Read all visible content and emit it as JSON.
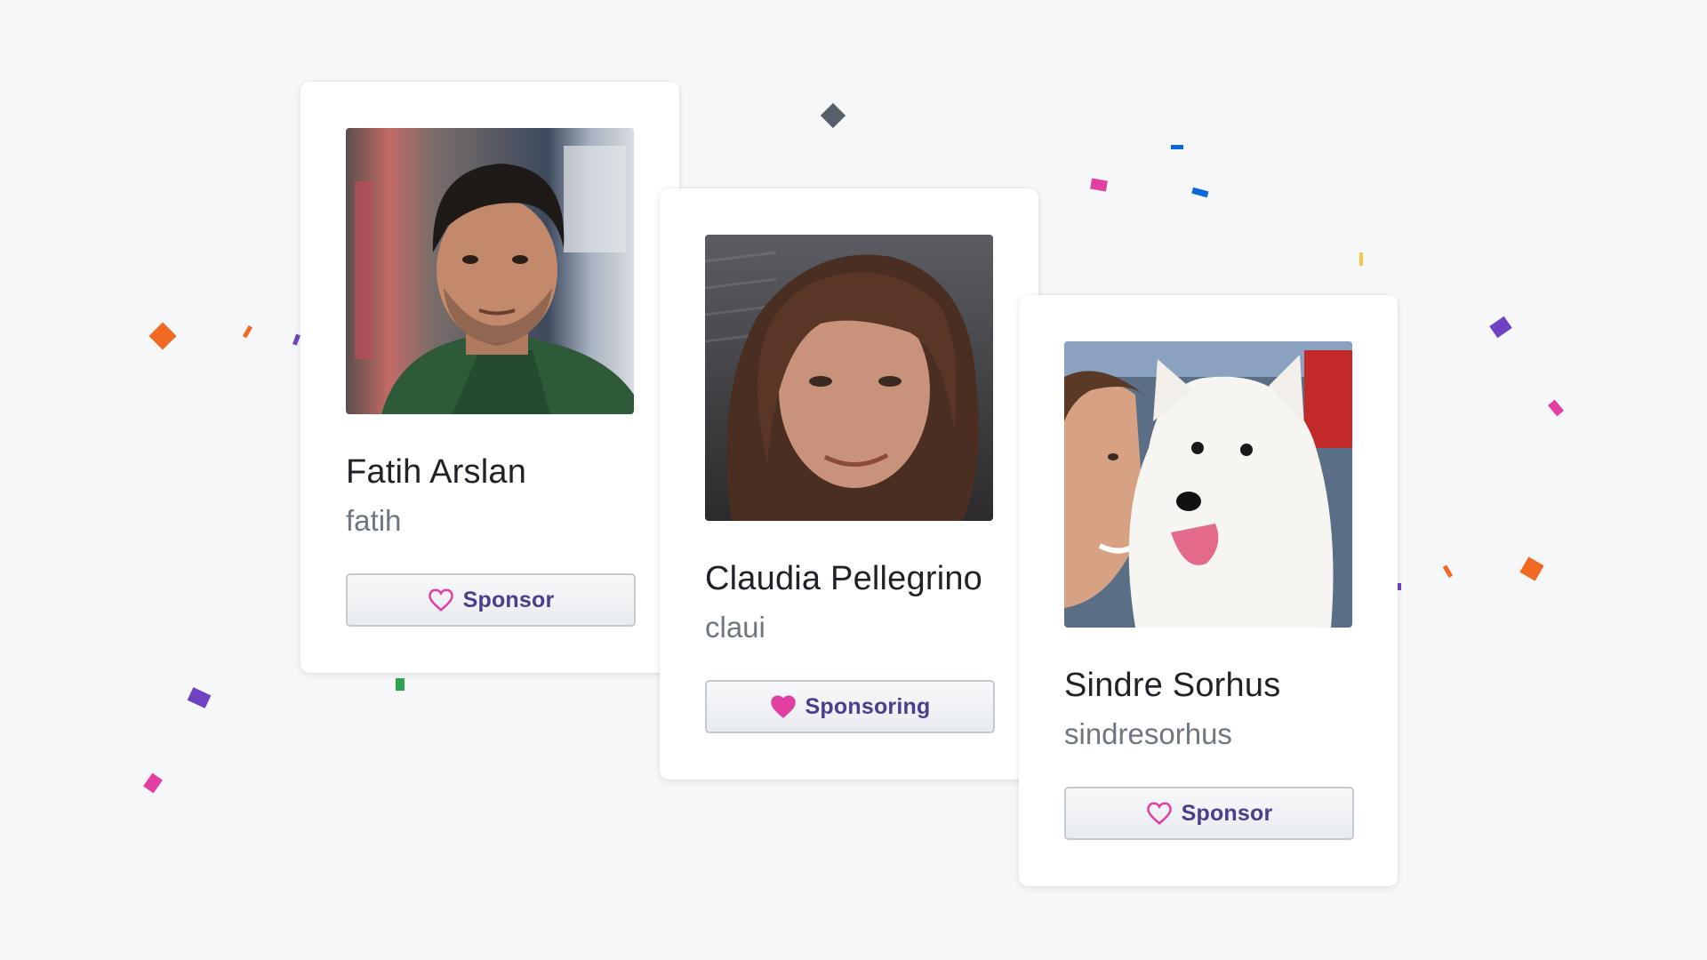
{
  "colors": {
    "background": "#f6f7f9",
    "heart": "#e33ea2",
    "button_text": "#4a3f8c",
    "name_text": "#1f2328",
    "handle_text": "#6e7781"
  },
  "cards": [
    {
      "name": "Fatih Arslan",
      "handle": "fatih",
      "button_label": "Sponsor",
      "button_state": "not-sponsoring",
      "heart_icon": "heart-outline-icon",
      "avatar": "photo of man with dark hair"
    },
    {
      "name": "Claudia Pellegrino",
      "handle": "claui",
      "button_label": "Sponsoring",
      "button_state": "sponsoring",
      "heart_icon": "heart-filled-icon",
      "avatar": "photo of woman with brown hair"
    },
    {
      "name": "Sindre Sorhus",
      "handle": "sindresorhus",
      "button_label": "Sponsor",
      "button_state": "not-sponsoring",
      "heart_icon": "heart-outline-icon",
      "avatar": "photo of man with white dog"
    }
  ]
}
